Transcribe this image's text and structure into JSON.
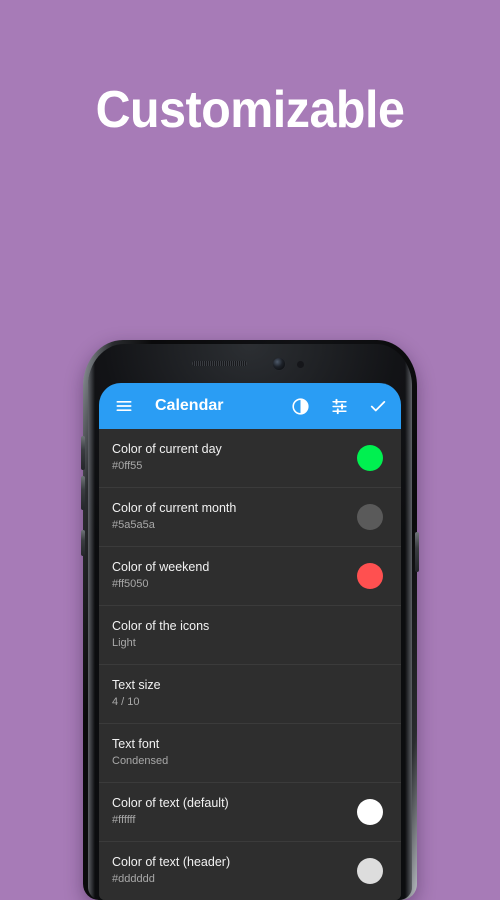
{
  "promo": {
    "headline": "Customizable"
  },
  "theme": {
    "page_background": "#a77bb7",
    "app_bar_color": "#2a9df4",
    "list_background": "#2e2e2e",
    "divider_color": "#3b3b3b",
    "title_text_color": "#f2f2f2",
    "value_text_color": "#a8a8a8"
  },
  "app_bar": {
    "title": "Calendar",
    "menu_icon": "hamburger-menu-icon",
    "actions": [
      {
        "icon": "contrast-icon"
      },
      {
        "icon": "tune-icon"
      },
      {
        "icon": "check-icon"
      }
    ]
  },
  "settings": {
    "rows": [
      {
        "title": "Color of current day",
        "value": "#0ff55",
        "swatch": "#00f050",
        "has_swatch": true
      },
      {
        "title": "Color of current month",
        "value": "#5a5a5a",
        "swatch": "#5a5a5a",
        "has_swatch": true
      },
      {
        "title": "Color of weekend",
        "value": "#ff5050",
        "swatch": "#ff5050",
        "has_swatch": true
      },
      {
        "title": "Color of the icons",
        "value": "Light",
        "swatch": "",
        "has_swatch": false
      },
      {
        "title": "Text size",
        "value": "4 / 10",
        "swatch": "",
        "has_swatch": false
      },
      {
        "title": "Text font",
        "value": "Condensed",
        "swatch": "",
        "has_swatch": false
      },
      {
        "title": "Color of text (default)",
        "value": "#ffffff",
        "swatch": "#ffffff",
        "has_swatch": true
      },
      {
        "title": "Color of text (header)",
        "value": "#dddddd",
        "swatch": "#dddddd",
        "has_swatch": true
      }
    ]
  }
}
